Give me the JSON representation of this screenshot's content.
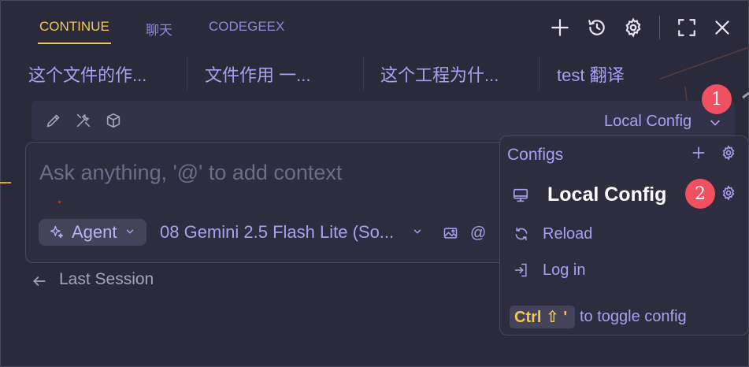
{
  "tabs": [
    {
      "label": "CONTINUE",
      "active": true
    },
    {
      "label": "聊天",
      "active": false
    },
    {
      "label": "CODEGEEX",
      "active": false
    }
  ],
  "toolbar_icons": [
    "plus-icon",
    "history-icon",
    "gear-icon",
    "fullscreen-icon",
    "close-icon"
  ],
  "history": [
    "这个文件的作...",
    "文件作用 一...",
    "这个工程为什...",
    "test 翻译"
  ],
  "mode_toolbar": {
    "icons": [
      "pencil-icon",
      "tools-icon",
      "cube-icon"
    ],
    "config_label": "Local Config"
  },
  "input": {
    "placeholder": "Ask anything, '@' to add context",
    "agent_label": "Agent",
    "model_label": "08 Gemini 2.5 Flash Lite (So...",
    "extra_icons": [
      "image-icon",
      "at-icon"
    ],
    "at_glyph": "@"
  },
  "back": {
    "label": "Last Session"
  },
  "config_dropdown": {
    "title": "Configs",
    "selected": "Local Config",
    "items": [
      {
        "icon": "reload-icon",
        "label": "Reload"
      },
      {
        "icon": "login-icon",
        "label": "Log in"
      }
    ],
    "shortcut_keys": "Ctrl ⇧ '",
    "shortcut_hint": "to toggle config"
  },
  "annotations": [
    "1",
    "2"
  ],
  "colors": {
    "background": "#2b2a3b",
    "accent_yellow": "#f2c94c",
    "accent_purple": "#a7a2f0",
    "badge_red": "#f05060"
  }
}
